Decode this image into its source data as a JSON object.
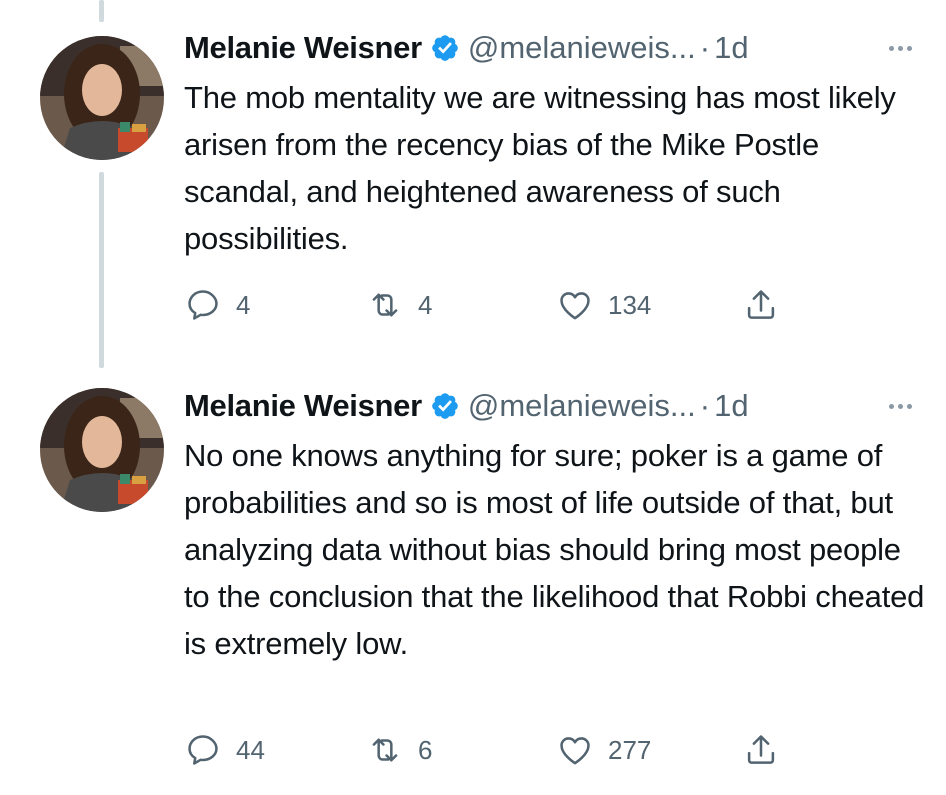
{
  "tweets": [
    {
      "author_name": "Melanie Weisner",
      "handle": "@melanieweis...",
      "separator": "·",
      "time": "1d",
      "text": "The mob mentality we are witnessing has most likely arisen from the recency bias of the Mike Postle scandal, and heightened awareness of such possibilities.",
      "replies": "4",
      "retweets": "4",
      "likes": "134"
    },
    {
      "author_name": "Melanie Weisner",
      "handle": "@melanieweis...",
      "separator": "·",
      "time": "1d",
      "text": "No one knows anything for sure; poker is a game of probabilities and so is most of life outside of that, but analyzing data without bias should bring most people to the conclusion that the likelihood that Robbi cheated is extremely low.",
      "replies": "44",
      "retweets": "6",
      "likes": "277"
    }
  ],
  "icons": {
    "verified": "verified-badge-icon",
    "more": "more-options-icon",
    "reply": "reply-icon",
    "retweet": "retweet-icon",
    "like": "heart-icon",
    "share": "share-icon"
  },
  "colors": {
    "verified": "#1d9bf0",
    "secondary_text": "#536471",
    "thread_line": "#cfd9de"
  }
}
